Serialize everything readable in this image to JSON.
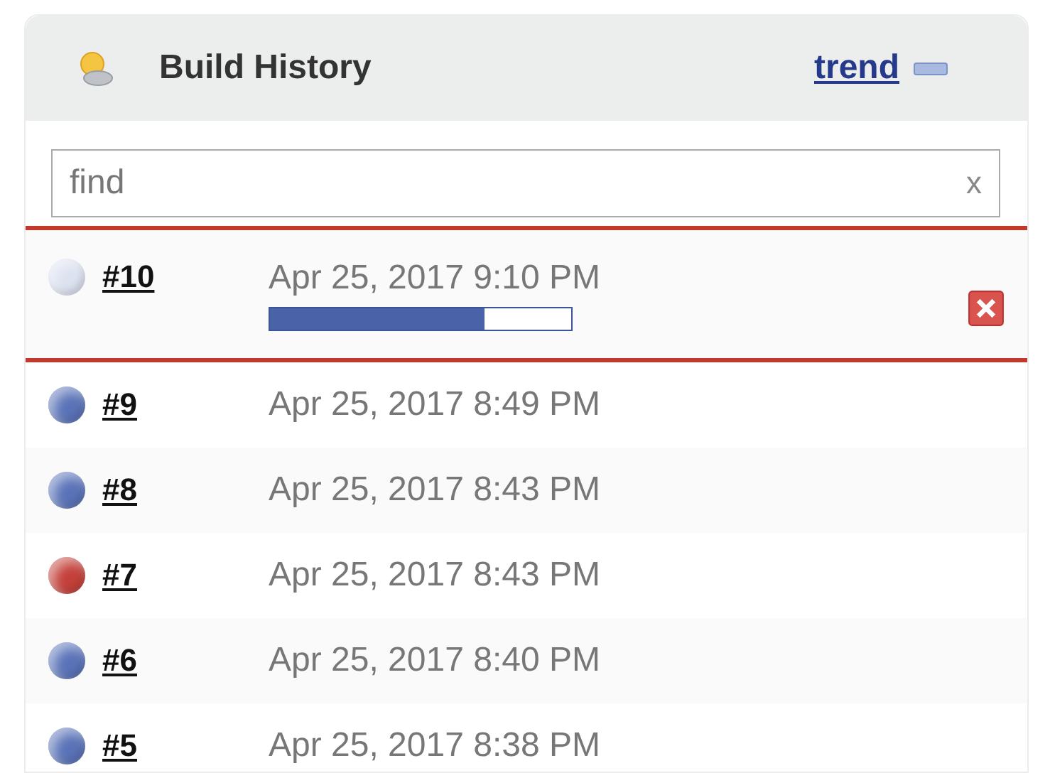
{
  "panel": {
    "title": "Build History",
    "trend_link": "trend",
    "collapsed": false
  },
  "search": {
    "placeholder": "find",
    "clear": "x"
  },
  "builds": [
    {
      "number": "#10",
      "time": "Apr 25, 2017 9:10 PM",
      "color": "#dde2f0",
      "level": 0.71,
      "highlighted": true
    },
    {
      "number": "#9",
      "time": "Apr 25, 2017 8:49 PM",
      "color": "#5a73b8",
      "highlighted": false
    },
    {
      "number": "#8",
      "time": "Apr 25, 2017 8:43 PM",
      "color": "#5a73b8",
      "highlighted": false
    },
    {
      "number": "#7",
      "time": "Apr 25, 2017 8:43 PM",
      "color": "#c4403a",
      "highlighted": false
    },
    {
      "number": "#6",
      "time": "Apr 25, 2017 8:40 PM",
      "color": "#5a73b8",
      "highlighted": false
    },
    {
      "number": "#5",
      "time": "Apr 25, 2017 8:38 PM",
      "color": "#5a73b8",
      "highlighted": false
    }
  ]
}
